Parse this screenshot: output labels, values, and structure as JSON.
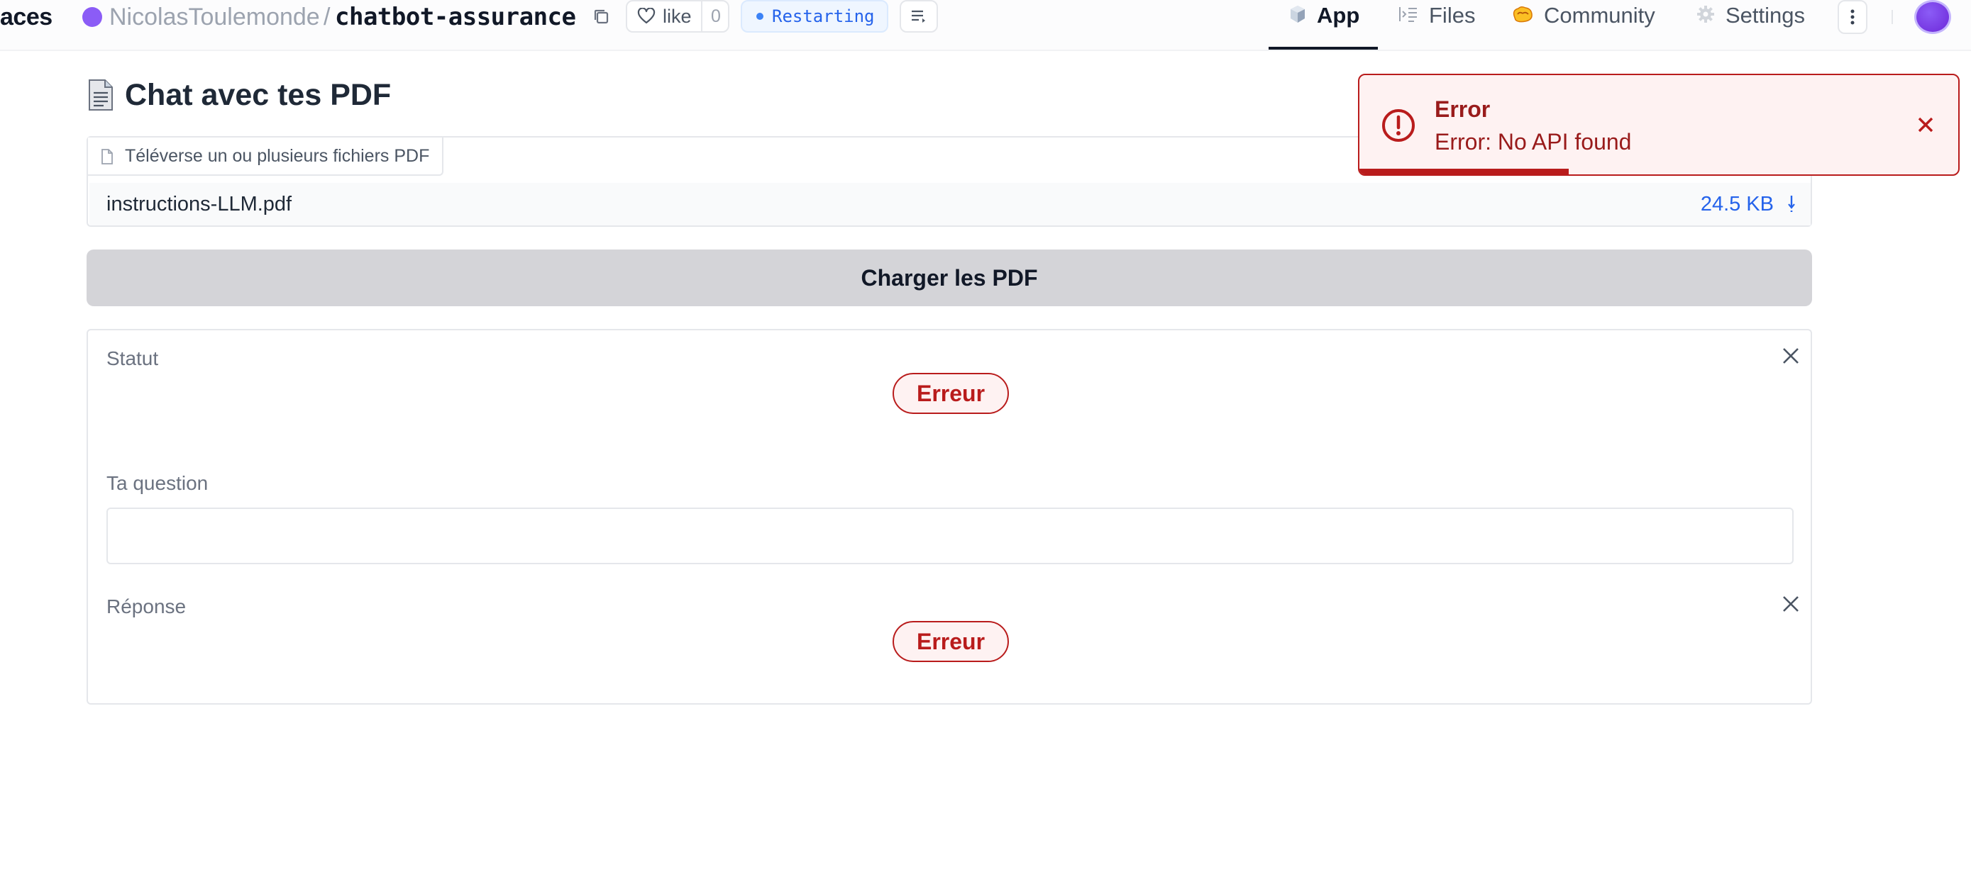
{
  "topbar": {
    "breadcrumb_prefix": "aces",
    "owner": "NicolasToulemonde",
    "separator": "/",
    "repo": "chatbot-assurance",
    "like_label": "like",
    "like_count": "0",
    "status": "Restarting",
    "tabs": [
      {
        "label": "App",
        "icon": "cube-icon",
        "active": true
      },
      {
        "label": "Files",
        "icon": "files-icon",
        "active": false
      },
      {
        "label": "Community",
        "icon": "community-icon",
        "active": false
      },
      {
        "label": "Settings",
        "icon": "gear-icon",
        "active": false
      }
    ]
  },
  "main": {
    "title": "Chat avec tes PDF",
    "upload": {
      "label": "Téléverse un ou plusieurs fichiers PDF",
      "file_name": "instructions-LLM.pdf",
      "file_size": "24.5 KB"
    },
    "load_button": "Charger les PDF",
    "statut_label": "Statut",
    "statut_value": "Erreur",
    "question_label": "Ta question",
    "question_value": "",
    "reponse_label": "Réponse",
    "reponse_value": "Erreur"
  },
  "toast": {
    "title": "Error",
    "message": "Error: No API found",
    "progress": 0.35
  },
  "colors": {
    "error": "#b91c1c",
    "error_bg": "#fef2f2",
    "link": "#2563eb",
    "button_bg": "#d4d4d8",
    "avatar": "#8b5cf6"
  }
}
